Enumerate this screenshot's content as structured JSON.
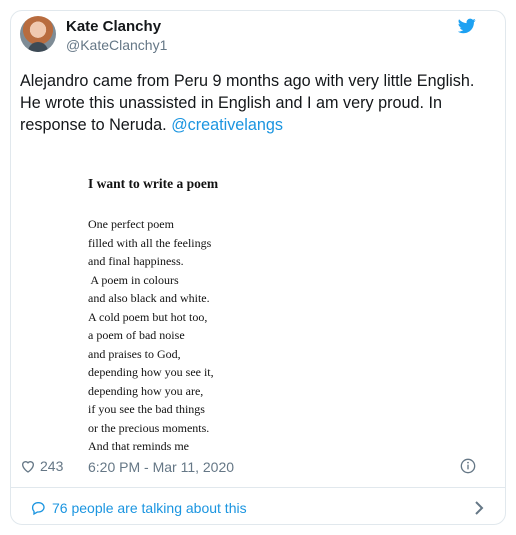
{
  "author": {
    "name": "Kate Clanchy",
    "handle": "@KateClanchy1"
  },
  "tweet": {
    "text_before": "Alejandro came from Peru 9 months ago with very little English. He wrote this unassisted in English and I am very proud. In response to Neruda. ",
    "mention": "@creativelangs"
  },
  "poem": {
    "title": "I want to write a poem",
    "lines": [
      "One perfect poem",
      "filled with all the feelings",
      "and final happiness.",
      " A poem in colours",
      "and also black and white.",
      "A cold poem but hot too,",
      "a poem of bad noise",
      "and praises to God,",
      "depending how you see it,",
      "depending how you are,",
      "if you see the bad things",
      "or the precious moments.",
      "And that reminds me"
    ]
  },
  "meta": {
    "likes": "243",
    "timestamp": "6:20 PM - Mar 11, 2020"
  },
  "footer": {
    "talking_label": "76 people are talking about this"
  },
  "colors": {
    "accent": "#1b95e0",
    "secondary_text": "#657786",
    "border": "#e1e8ed"
  },
  "icons": {
    "brand": "twitter-bird-icon",
    "like": "heart-icon",
    "info": "info-icon",
    "conversation": "speech-bubble-icon",
    "navigate": "chevron-right-icon"
  }
}
